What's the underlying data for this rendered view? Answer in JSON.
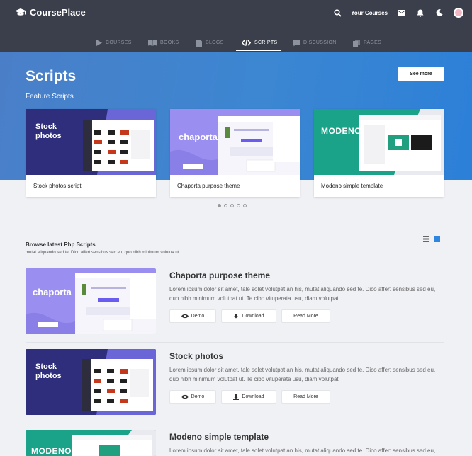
{
  "app": {
    "brand": "CoursePlace",
    "your_courses": "Your Courses"
  },
  "nav": [
    {
      "label": "COURSES"
    },
    {
      "label": "BOOKS"
    },
    {
      "label": "BLOGS"
    },
    {
      "label": "SCRIPTS",
      "active": true
    },
    {
      "label": "DISCUSSION"
    },
    {
      "label": "PAGES"
    }
  ],
  "hero": {
    "title": "Scripts",
    "subtitle": "Feature Scripts",
    "see_more": "See more"
  },
  "featured": [
    {
      "caption": "Stock photos script",
      "thumb_title": "Stock photos"
    },
    {
      "caption": "Chaporta purpose theme",
      "thumb_title": "chaporta"
    },
    {
      "caption": "Modeno simple template",
      "thumb_title": "MODENO"
    }
  ],
  "carousel": {
    "pages": 5,
    "active": 1
  },
  "browse": {
    "title": "Browse latest Php Scripts",
    "description": "mutat aliquando sed te. Dico affert sensibus sed eu, quo nibh minimum volutua ut."
  },
  "list": [
    {
      "title": "Chaporta purpose theme",
      "thumb_title": "chaporta",
      "desc": "Lorem ipsum dolor sit amet, tale solet volutpat an his, mutat aliquando sed te. Dico affert sensibus sed eu, quo nibh minimum volutpat ut. Te cibo vituperata usu, diam volutpat",
      "demo": "Demo",
      "download": "Download",
      "read_more": "Read More"
    },
    {
      "title": "Stock photos",
      "thumb_title": "Stock photos",
      "desc": "Lorem ipsum dolor sit amet, tale solet volutpat an his, mutat aliquando sed te. Dico affert sensibus sed eu, quo nibh minimum volutpat ut. Te cibo vituperata usu, diam volutpat",
      "demo": "Demo",
      "download": "Download",
      "read_more": "Read More"
    },
    {
      "title": "Modeno simple template",
      "thumb_title": "MODENO",
      "desc": "Lorem ipsum dolor sit amet, tale solet volutpat an his, mutat aliquando sed te. Dico affert sensibus sed eu,"
    }
  ],
  "colors": {
    "topbar": "#3a3f4b",
    "hero": "#3c86d2",
    "stock": "#2e2e7c",
    "chaporta": "#9a8ff0",
    "modeno": "#1aa388"
  }
}
